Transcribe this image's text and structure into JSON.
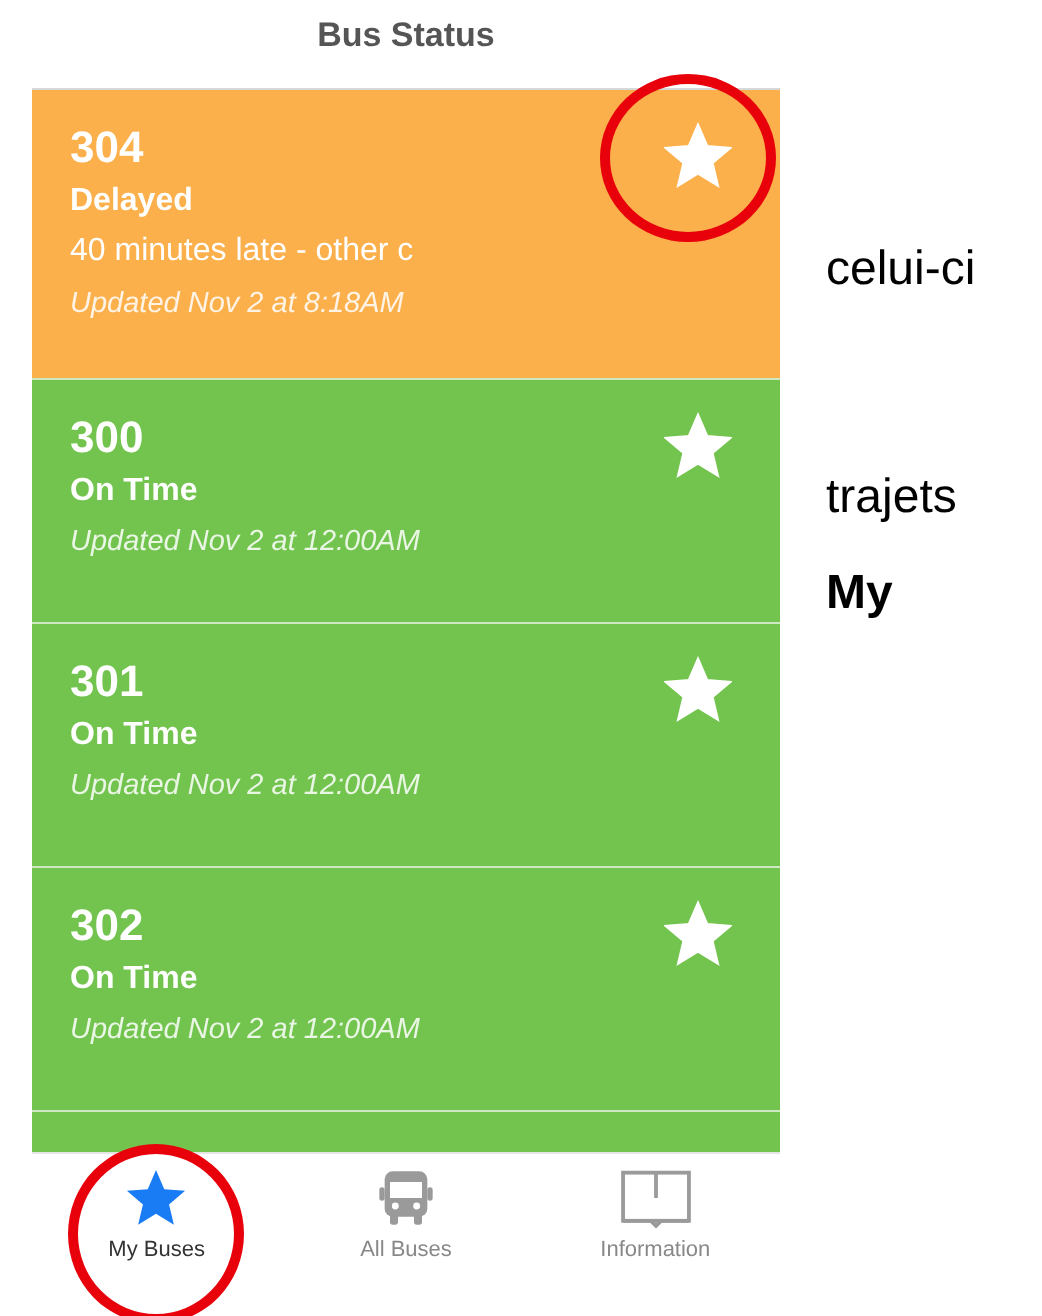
{
  "header": {
    "title": "Bus Status"
  },
  "buses": [
    {
      "number": "304",
      "kind": "delayed",
      "status": "Delayed",
      "detail": "40 minutes late - other c",
      "updated": "Updated Nov 2 at 8:18AM",
      "favorite": true,
      "circled": true
    },
    {
      "number": "300",
      "kind": "on_time",
      "status": "On Time",
      "updated": "Updated Nov 2 at 12:00AM",
      "favorite": true,
      "circled": false
    },
    {
      "number": "301",
      "kind": "on_time",
      "status": "On Time",
      "updated": "Updated Nov 2 at 12:00AM",
      "favorite": true,
      "circled": false
    },
    {
      "number": "302",
      "kind": "on_time",
      "status": "On Time",
      "updated": "Updated Nov 2 at 12:00AM",
      "favorite": true,
      "circled": false
    }
  ],
  "tab_bar": [
    {
      "label": "My Buses",
      "kind": "star",
      "selected": true,
      "circled": true
    },
    {
      "label": "All Buses",
      "kind": "bus",
      "selected": false,
      "circled": false
    },
    {
      "label": "Information",
      "kind": "book",
      "selected": false,
      "circled": false
    }
  ],
  "side_text": [
    {
      "text": "celui-ci",
      "bold": false
    },
    {
      "text": "trajets",
      "bold": false
    },
    {
      "text": "My",
      "bold": true
    }
  ]
}
